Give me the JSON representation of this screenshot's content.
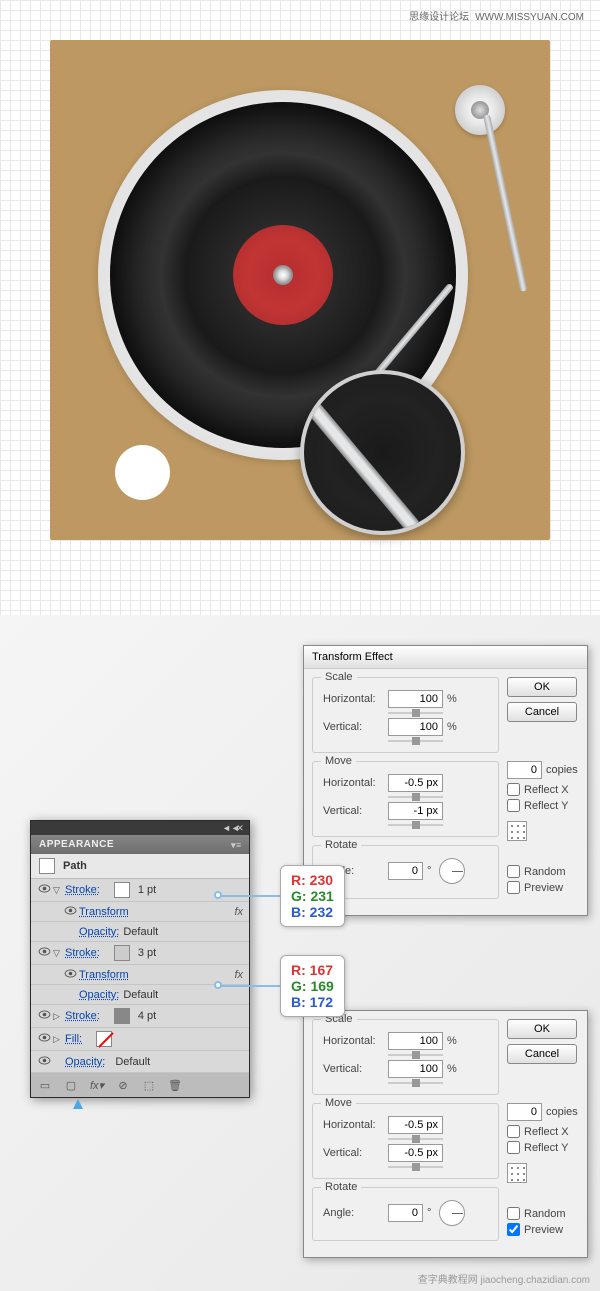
{
  "watermark": {
    "cn": "思缘设计论坛",
    "url": "WWW.MISSYUAN.COM"
  },
  "watermark2": "查字典教程网 jiaocheng.chazidian.com",
  "dialog1": {
    "title": "Transform Effect",
    "scale": {
      "label": "Scale",
      "hLabel": "Horizontal:",
      "hVal": "100",
      "hUnit": "%",
      "vLabel": "Vertical:",
      "vVal": "100",
      "vUnit": "%"
    },
    "move": {
      "label": "Move",
      "hLabel": "Horizontal:",
      "hVal": "-0.5 px",
      "vLabel": "Vertical:",
      "vVal": "-1 px"
    },
    "rotate": {
      "label": "Rotate",
      "angleLabel": "Angle:",
      "angleVal": "0",
      "angleUnit": "°"
    },
    "ok": "OK",
    "cancel": "Cancel",
    "copiesVal": "0",
    "copiesLabel": "copies",
    "reflectX": "Reflect X",
    "reflectY": "Reflect Y",
    "random": "Random",
    "preview": "Preview"
  },
  "dialog2": {
    "scale": {
      "label": "Scale",
      "hLabel": "Horizontal:",
      "hVal": "100",
      "hUnit": "%",
      "vLabel": "Vertical:",
      "vVal": "100",
      "vUnit": "%"
    },
    "move": {
      "label": "Move",
      "hLabel": "Horizontal:",
      "hVal": "-0.5 px",
      "vLabel": "Vertical:",
      "vVal": "-0.5 px"
    },
    "rotate": {
      "label": "Rotate",
      "angleLabel": "Angle:",
      "angleVal": "0",
      "angleUnit": "°"
    },
    "ok": "OK",
    "cancel": "Cancel",
    "copiesVal": "0",
    "copiesLabel": "copies",
    "reflectX": "Reflect X",
    "reflectY": "Reflect Y",
    "random": "Random",
    "preview": "Preview"
  },
  "panel": {
    "title": "APPEARANCE",
    "path": "Path",
    "stroke": "Stroke:",
    "fill": "Fill:",
    "transform": "Transform",
    "opacity": "Opacity:",
    "default": "Default",
    "pt1": "1 pt",
    "pt3": "3 pt",
    "pt4": "4 pt",
    "fx": "fx"
  },
  "rgb1": {
    "r": "R: 230",
    "g": "G: 231",
    "b": "B: 232"
  },
  "rgb2": {
    "r": "R: 167",
    "g": "G: 169",
    "b": "B: 172"
  }
}
